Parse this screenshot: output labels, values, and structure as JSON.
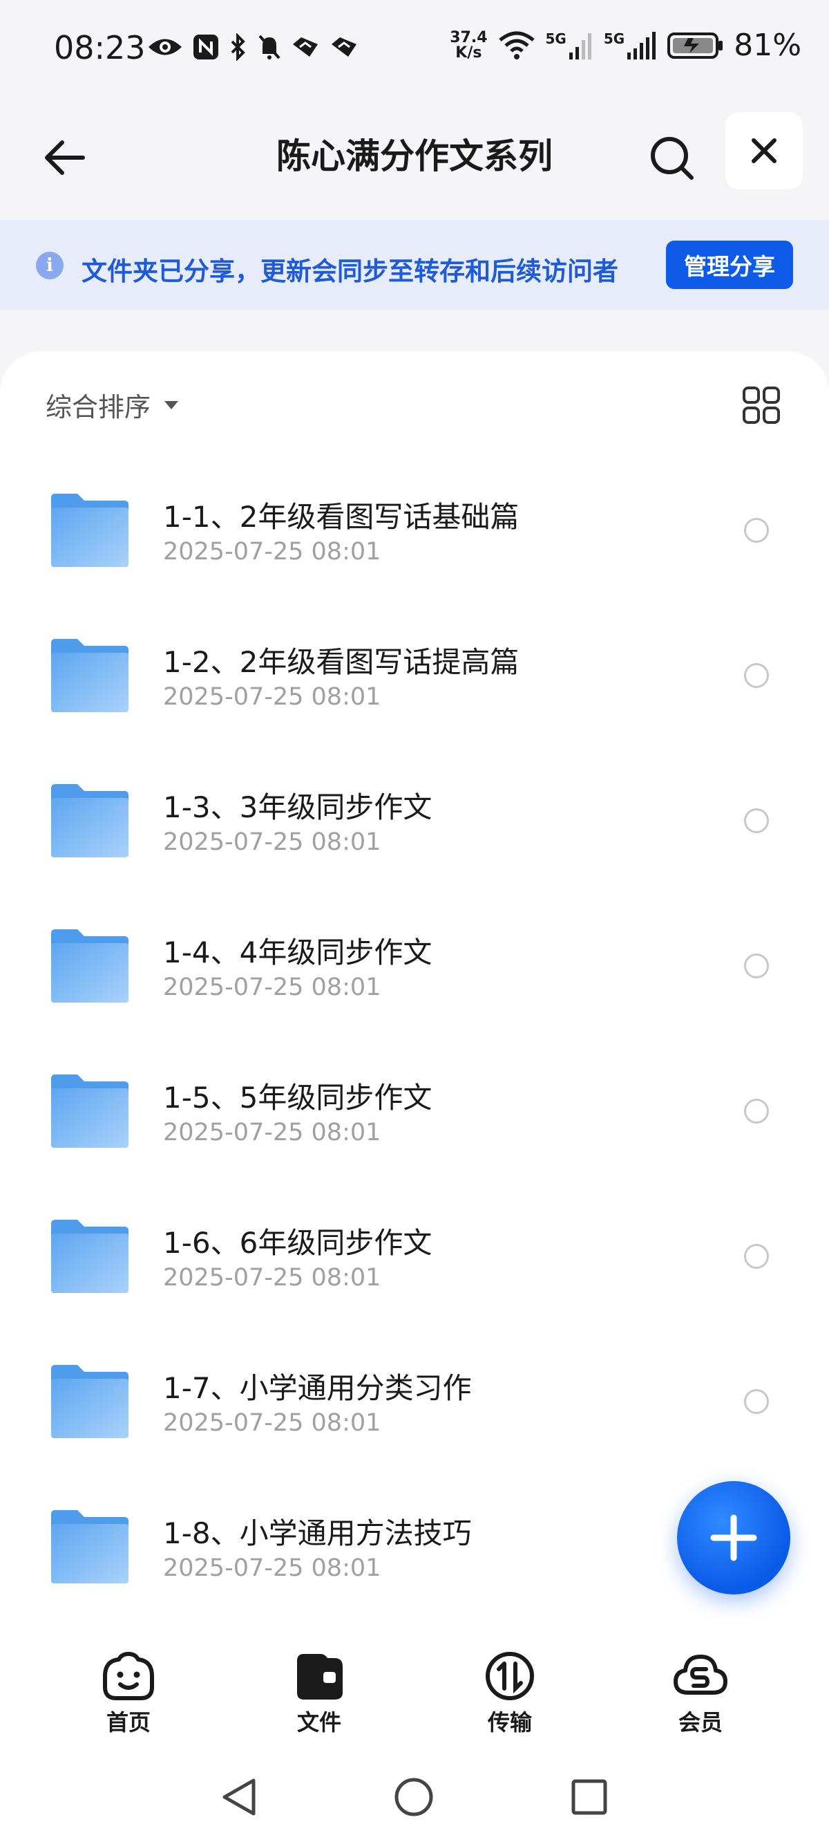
{
  "status_bar": {
    "time": "08:23",
    "net_speed_value": "37.4",
    "net_speed_unit": "K/s",
    "signal_label_1": "5G",
    "signal_label_2": "5G",
    "battery_percent": "81%"
  },
  "header": {
    "title": "陈心满分作文系列"
  },
  "share_banner": {
    "message": "文件夹已分享，更新会同步至转存和后续访问者",
    "button_label": "管理分享"
  },
  "toolbar": {
    "sort_label": "综合排序"
  },
  "files": [
    {
      "name": "1-1、2年级看图写话基础篇",
      "date": "2025-07-25 08:01"
    },
    {
      "name": "1-2、2年级看图写话提高篇",
      "date": "2025-07-25 08:01"
    },
    {
      "name": "1-3、3年级同步作文",
      "date": "2025-07-25 08:01"
    },
    {
      "name": "1-4、4年级同步作文",
      "date": "2025-07-25 08:01"
    },
    {
      "name": "1-5、5年级同步作文",
      "date": "2025-07-25 08:01"
    },
    {
      "name": "1-6、6年级同步作文",
      "date": "2025-07-25 08:01"
    },
    {
      "name": "1-7、小学通用分类习作",
      "date": "2025-07-25 08:01"
    },
    {
      "name": "1-8、小学通用方法技巧",
      "date": "2025-07-25 08:01"
    }
  ],
  "bottom_nav": {
    "items": [
      {
        "label": "首页",
        "icon": "smile-face-icon"
      },
      {
        "label": "文件",
        "icon": "folder-wallet-icon"
      },
      {
        "label": "传输",
        "icon": "transfer-icon"
      },
      {
        "label": "会员",
        "icon": "cloud-member-icon"
      }
    ]
  },
  "colors": {
    "accent": "#0d5be6",
    "banner_bg": "#e6ecfa",
    "banner_text": "#1f5bd8",
    "folder_blue": "#7ab8f5"
  }
}
